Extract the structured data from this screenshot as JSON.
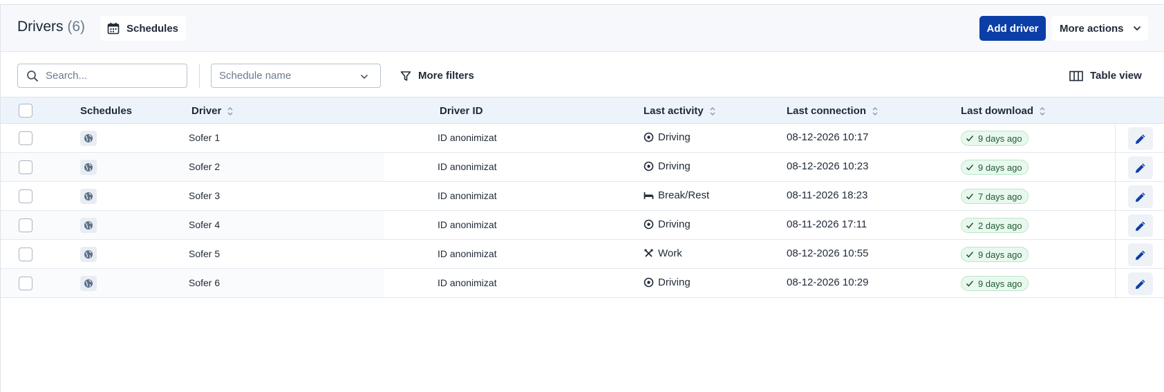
{
  "header": {
    "title": "Drivers",
    "count": "(6)",
    "schedules_button": "Schedules",
    "add_driver": "Add driver",
    "more_actions": "More actions"
  },
  "filters": {
    "search_placeholder": "Search...",
    "schedule_placeholder": "Schedule name",
    "more_filters": "More filters",
    "table_view": "Table view"
  },
  "table": {
    "columns": {
      "schedules": "Schedules",
      "driver": "Driver",
      "driver_id": "Driver ID",
      "last_activity": "Last activity",
      "last_connection": "Last connection",
      "last_download": "Last download"
    },
    "rows": [
      {
        "driver": "Sofer 1",
        "driver_id": "ID anonimizat",
        "activity": "Driving",
        "activity_icon": "driving-icon",
        "connection": "08-12-2026 10:17",
        "download": "9 days ago"
      },
      {
        "driver": "Sofer 2",
        "driver_id": "ID anonimizat",
        "activity": "Driving",
        "activity_icon": "driving-icon",
        "connection": "08-12-2026 10:23",
        "download": "9 days ago"
      },
      {
        "driver": "Sofer 3",
        "driver_id": "ID anonimizat",
        "activity": "Break/Rest",
        "activity_icon": "bed-icon",
        "connection": "08-11-2026 18:23",
        "download": "7 days ago"
      },
      {
        "driver": "Sofer 4",
        "driver_id": "ID anonimizat",
        "activity": "Driving",
        "activity_icon": "driving-icon",
        "connection": "08-11-2026 17:11",
        "download": "2 days ago"
      },
      {
        "driver": "Sofer 5",
        "driver_id": "ID anonimizat",
        "activity": "Work",
        "activity_icon": "tools-icon",
        "connection": "08-12-2026 10:55",
        "download": "9 days ago"
      },
      {
        "driver": "Sofer 6",
        "driver_id": "ID anonimizat",
        "activity": "Driving",
        "activity_icon": "driving-icon",
        "connection": "08-12-2026 10:29",
        "download": "9 days ago"
      }
    ]
  },
  "colors": {
    "primary": "#0c3ea8",
    "header_bg": "#f6f8fb",
    "table_header_bg": "#edf3fb",
    "badge_bg": "#e9f8ee",
    "badge_text": "#1f5a32",
    "edit_icon": "#0c3ea8"
  }
}
